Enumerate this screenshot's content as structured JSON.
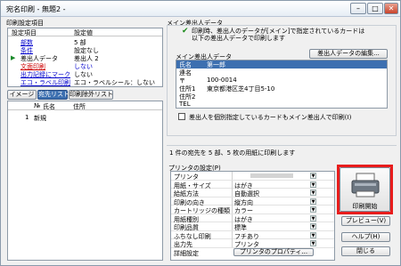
{
  "window": {
    "title": "宛名印刷 - 無題2 -",
    "minimize": "–",
    "maximize": "□",
    "close": "✕"
  },
  "left": {
    "group_title": "印刷設定項目",
    "columns": [
      "設定項目",
      "設定値"
    ],
    "items": [
      {
        "label": "部数",
        "value": "5 部",
        "style": "blue"
      },
      {
        "label": "条件",
        "value": "設定なし",
        "style": "blue"
      },
      {
        "label": "差出人データ",
        "value": "差出人 2",
        "style": "selected"
      },
      {
        "label": "文面印刷",
        "value": "しない",
        "style": "red"
      },
      {
        "label": "出力記録にマーク",
        "value": "しない",
        "style": "blue"
      },
      {
        "label": "エコ・ラベル印刷",
        "value": "エコ・ラベルシール：しない",
        "style": "blue"
      }
    ],
    "tabs": [
      "イメージ",
      "宛先リスト",
      "印刷除外リスト"
    ],
    "list_columns": [
      "№",
      "氏名",
      "住所"
    ],
    "list_rows": [
      {
        "no": "1",
        "name": "新規",
        "addr": ""
      }
    ]
  },
  "right": {
    "main_sender_group": "メイン差出人データ",
    "notice": "印刷時、差出人のデータが[メイン]で指定されているカードは以下の差出人データで印刷します",
    "sub_label": "メイン差出人データ",
    "edit_button": "差出人データの編集...",
    "sender_rows": [
      {
        "k": "氏名",
        "v": "第一郎"
      },
      {
        "k": "連名",
        "v": ""
      },
      {
        "k": "〒",
        "v": "100-0014"
      },
      {
        "k": "住所1",
        "v": "東京都港区芝4丁目5-10"
      },
      {
        "k": "住所2",
        "v": ""
      },
      {
        "k": "TEL",
        "v": ""
      }
    ],
    "checkbox_label": "差出人を個別指定しているカードもメイン差出人で印刷(I)",
    "summary": "1 件の宛先を 5 部、5 枚の用紙に印刷します",
    "printer_group": "プリンタの設定(P)",
    "printer_rows": [
      {
        "k": "プリンタ",
        "v": ""
      },
      {
        "k": "用紙・サイズ",
        "v": "はがき"
      },
      {
        "k": "給紙方法",
        "v": "自動選択"
      },
      {
        "k": "印刷の向き",
        "v": "縦方向"
      },
      {
        "k": "カートリッジの種類",
        "v": "カラー"
      },
      {
        "k": "用紙種別",
        "v": "はがき"
      },
      {
        "k": "印刷品質",
        "v": "標準"
      },
      {
        "k": "ふちなし印刷",
        "v": "フチあり"
      },
      {
        "k": "出力先",
        "v": "プリンタ"
      },
      {
        "k": "詳細設定",
        "v": "プリンタのプロパティ..."
      }
    ],
    "print_button": "印刷開始",
    "preview_button": "プレビュー(V)",
    "help_button": "ヘルプ(H)",
    "close_button": "閉じる",
    "accent": "#e81c1c"
  }
}
